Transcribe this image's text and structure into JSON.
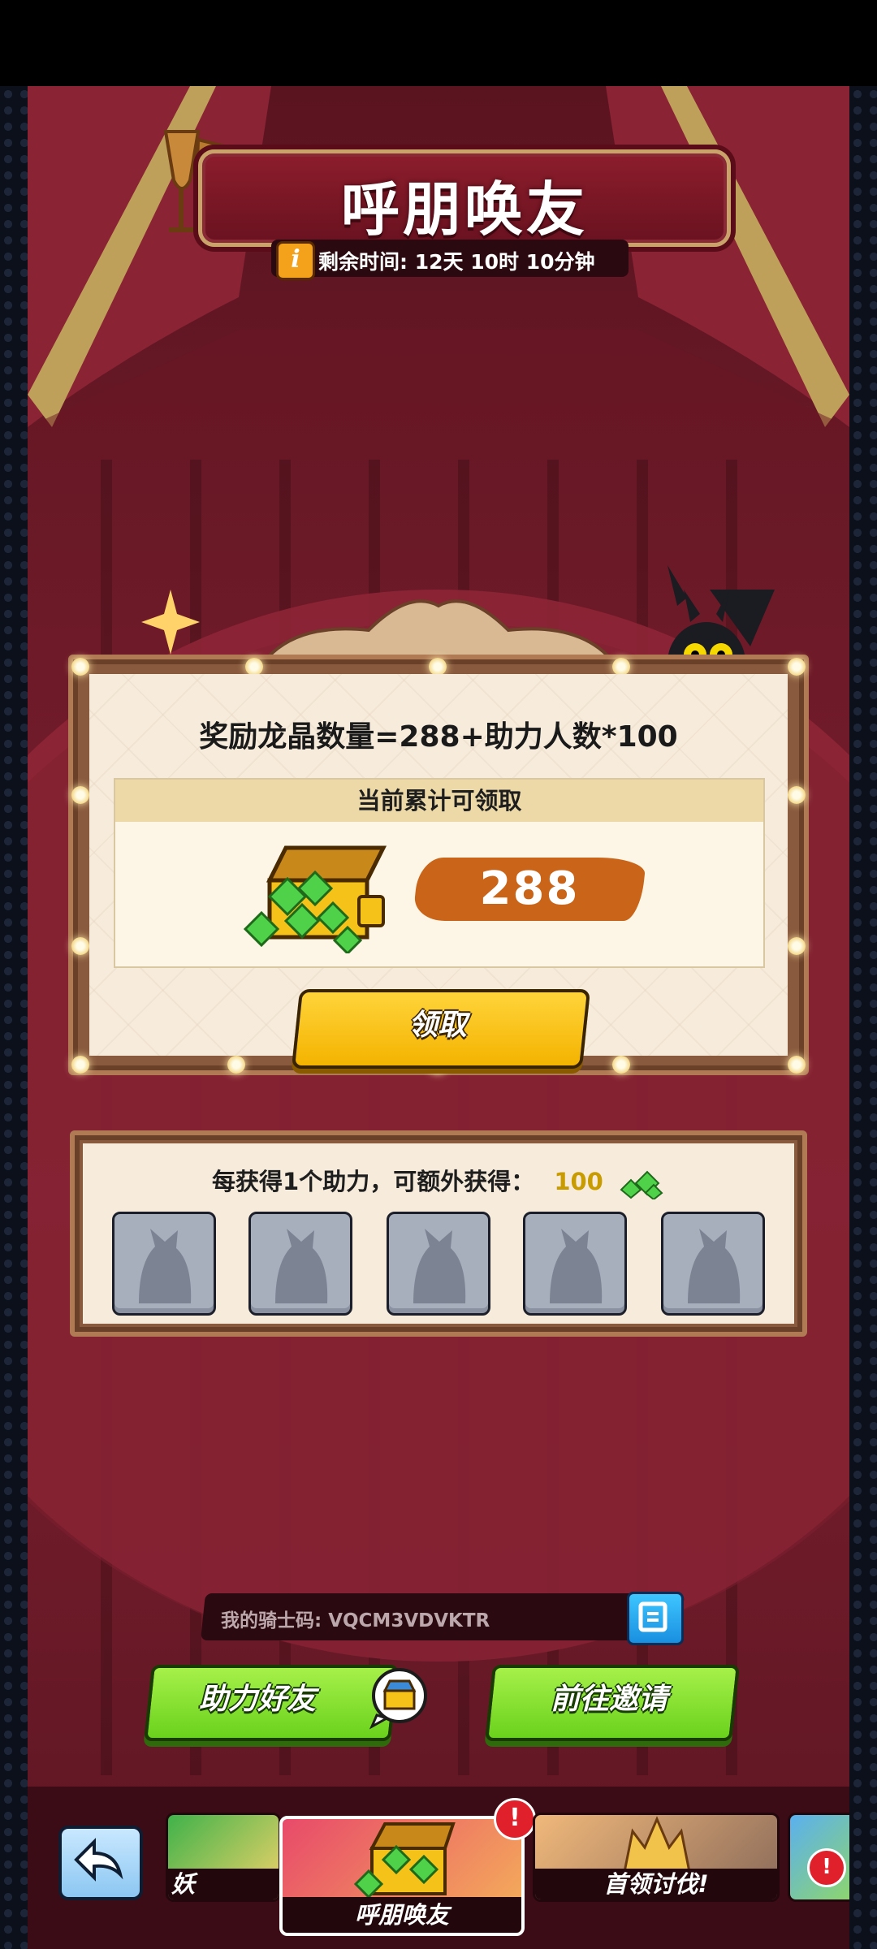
{
  "event": {
    "title": "呼朋唤友",
    "timer_label": "剩余时间: 12天 10时 10分钟",
    "info_icon": "i"
  },
  "reward": {
    "formula": "奖励龙晶数量=288+助力人数*100",
    "header": "当前累计可领取",
    "amount": "288",
    "claim_label": "领取"
  },
  "bonus": {
    "text": "每获得1个助力，可额外获得：",
    "amount": "100",
    "slots": 5
  },
  "knight_code": {
    "label": "我的骑士码: VQCM3VDVKTR"
  },
  "actions": {
    "help_friend": "助力好友",
    "go_invite": "前往邀请"
  },
  "nav": {
    "tabs": [
      {
        "label": "妖"
      },
      {
        "label": "呼朋唤友"
      },
      {
        "label": "首领讨伐!"
      }
    ],
    "badge": "!"
  },
  "colors": {
    "background": "#6e1a28",
    "accent_green": "#6ad21c",
    "accent_yellow": "#f4b300",
    "amount_orange": "#c96418"
  },
  "icons": [
    "info-icon",
    "gem-chest-icon",
    "gem-icon",
    "copy-icon",
    "chest-icon",
    "back-arrow-icon",
    "alert-icon",
    "sparkle-icon",
    "avatar-placeholder-icon"
  ]
}
